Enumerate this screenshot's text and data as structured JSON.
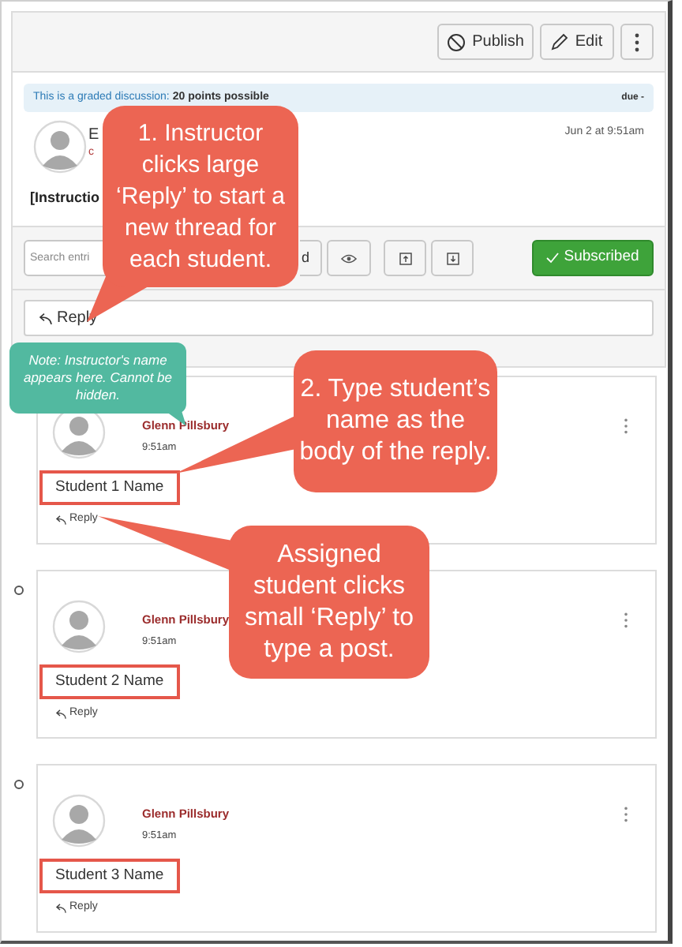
{
  "toolbar": {
    "buttons": [
      {
        "kind": "publish",
        "label": "Publish"
      },
      {
        "kind": "edit",
        "label": "Edit"
      },
      {
        "kind": "more"
      }
    ]
  },
  "discussion": {
    "graded_notice": {
      "label": "This is a graded discussion:",
      "points": "20 points possible",
      "due": "due -"
    },
    "author_fragment": "E",
    "role_fragment": "c",
    "date": "Jun 2 at 9:51am",
    "body_fragment": "[Instructio"
  },
  "controls": {
    "search": {
      "placeholder": "Search entri"
    },
    "filter_fragment": "d",
    "subscribed": {
      "label": "Subscribed",
      "on": true
    }
  },
  "reply_button": {
    "label": "Reply"
  },
  "threads": [
    {
      "author": "Glenn Pillsbury",
      "time": "9:51am",
      "body": "Student 1 Name",
      "highlighted": true,
      "reply": "Reply",
      "marker": false
    },
    {
      "author": "Glenn Pillsbury",
      "time": "9:51am",
      "body": "Student 2 Name",
      "highlighted": true,
      "reply": "Reply",
      "marker": true
    },
    {
      "author": "Glenn Pillsbury",
      "time": "9:51am",
      "body": "Student 3 Name",
      "highlighted": true,
      "reply": "Reply",
      "marker": true
    }
  ],
  "callouts": [
    {
      "kind": "step",
      "text": "1. Instructor clicks large ‘Reply’ to start a new thread for each student."
    },
    {
      "kind": "note",
      "text": "Note: Instructor's name appears here. Cannot be hidden."
    },
    {
      "kind": "step",
      "text": "2. Type student’s name as the body of the reply."
    },
    {
      "kind": "step",
      "text": "Assigned student clicks small ‘Reply’ to type a post."
    }
  ]
}
